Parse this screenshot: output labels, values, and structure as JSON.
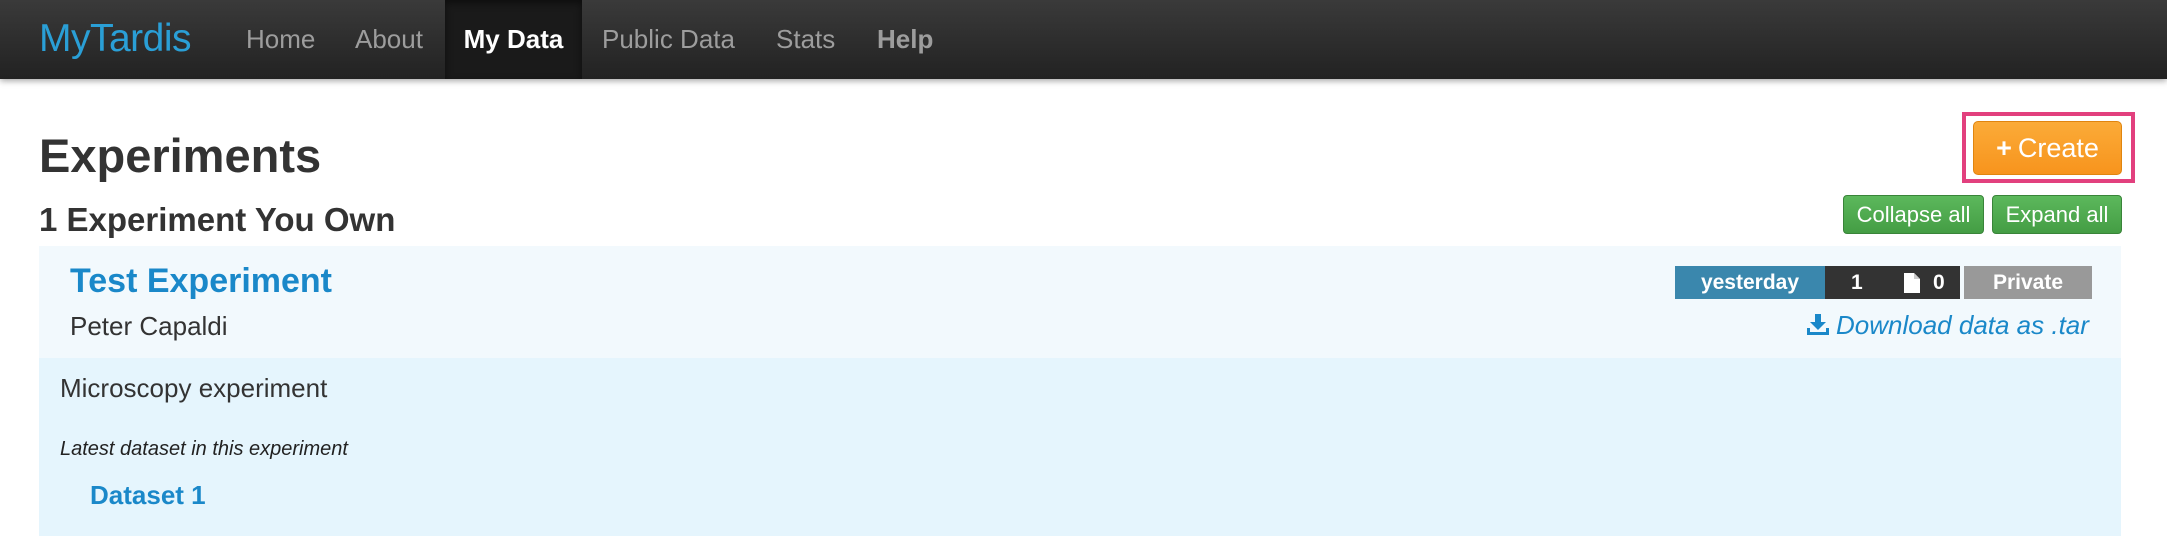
{
  "navbar": {
    "brand": "MyTardis",
    "items": [
      {
        "label": "Home"
      },
      {
        "label": "About"
      },
      {
        "label": "My Data"
      },
      {
        "label": "Public Data"
      },
      {
        "label": "Stats"
      },
      {
        "label": "Help"
      }
    ],
    "active_item": "My Data"
  },
  "page": {
    "title": "Experiments",
    "section_title": "1 Experiment You Own"
  },
  "toolbar": {
    "create_label": "Create",
    "create_icon": "plus-icon",
    "collapse_all_label": "Collapse all",
    "expand_all_label": "Expand all"
  },
  "experiment": {
    "title": "Test Experiment",
    "owner": "Peter Capaldi",
    "badges": {
      "date": "yesterday",
      "dataset_count": "1",
      "file_count": "0",
      "visibility": "Private"
    },
    "download_label": "Download data as .tar",
    "description": "Microscopy experiment",
    "latest_dataset_label": "Latest dataset in this experiment",
    "latest_dataset": "Dataset 1"
  },
  "colors": {
    "brand": "#2a9fd6",
    "create_button": "#f7941d",
    "highlight": "#e2407e",
    "green_button": "#5cb85c",
    "link": "#1a88c9",
    "badge_date": "#3a87ad",
    "badge_count": "#333333",
    "badge_private": "#999999"
  }
}
